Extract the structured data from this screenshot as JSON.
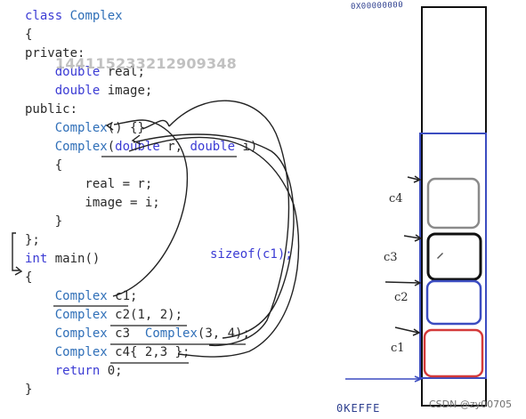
{
  "code_lines": [
    {
      "text": "class Complex",
      "kw": "class"
    },
    {
      "text": "{"
    },
    {
      "text": "private:",
      "kw": "private:"
    },
    {
      "text": "    double real;",
      "kw": "double"
    },
    {
      "text": "    double image;",
      "kw": "double"
    },
    {
      "text": "public:",
      "kw": "public:"
    },
    {
      "text": "    Complex() {}"
    },
    {
      "text": "    Complex(double r, double i)"
    },
    {
      "text": "    {"
    },
    {
      "text": "        real = r;"
    },
    {
      "text": "        image = i;"
    },
    {
      "text": "    }"
    },
    {
      "text": "};"
    },
    {
      "text": "int main()",
      "kw": "int"
    },
    {
      "text": "{"
    },
    {
      "text": "    Complex c1;"
    },
    {
      "text": "    Complex c2(1, 2);"
    },
    {
      "text": "    Complex c3  Complex(3, 4);"
    },
    {
      "text": "    Complex c4{ 2,3 };"
    },
    {
      "text": "    return 0;",
      "kw": "return"
    },
    {
      "text": "}"
    }
  ],
  "watermark_id": "1441152332129093​48",
  "sizeof_note": "sizeof(c1);",
  "stack_labels": {
    "c4": "c4",
    "c3": "c3",
    "c2": "c2",
    "c1": "c1"
  },
  "top_address": "0X00000000",
  "bottom_address": "0KEFFE",
  "csdn_watermark": "CSDN @zy00705",
  "colors": {
    "frame": "#111111",
    "stack_region": "#3b4cc0",
    "box_c4": "#8a8a8a",
    "box_c3": "#111111",
    "box_c2": "#3b4cc0",
    "box_c1": "#d43a3a",
    "keyword": "#3b3bd4"
  }
}
